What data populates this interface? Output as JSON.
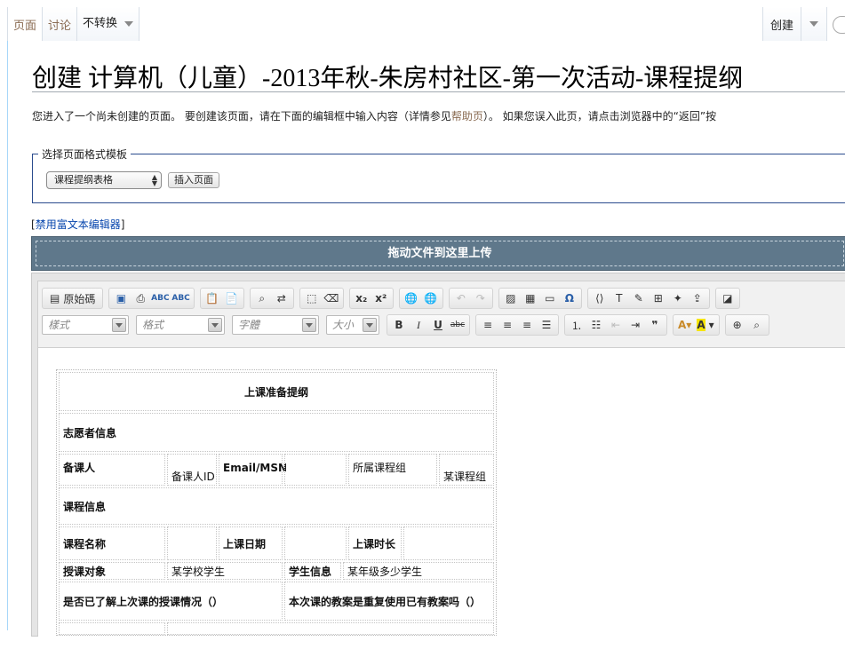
{
  "tabs": {
    "page": "页面",
    "talk": "讨论",
    "variant": "不转换",
    "create": "创建"
  },
  "title": "创建 计算机（儿童）-2013年秋-朱房村社区-第一次活动-课程提纲",
  "intro": {
    "before": "您进入了一个尚未创建的页面。 要创建该页面，请在下面的编辑框中输入内容（详情参见",
    "link": "帮助页",
    "after": "）。 如果您误入此页，请点击浏览器中的“返回”按"
  },
  "template_box": {
    "legend": "选择页面格式模板",
    "selected": "课程提纲表格",
    "insert_button": "插入页面"
  },
  "rte_toggle": {
    "open": "[",
    "link": "禁用富文本编辑器",
    "close": "]"
  },
  "upload": {
    "label": "拖动文件到这里上传"
  },
  "toolbar": {
    "source": "原始碼",
    "styles": "樣式",
    "format": "格式",
    "font": "字體",
    "size": "大小",
    "spell1": "ABC",
    "spell2": "ABC",
    "strike": "abc"
  },
  "doc": {
    "heading": "上课准备提纲",
    "volunteer_info": "志愿者信息",
    "preparer": "备课人",
    "preparer_id": "备课人ID",
    "email": "Email/MSN",
    "course_group": "所属课程组",
    "course_group_value": "某课程组",
    "course_info": "课程信息",
    "course_name": "课程名称",
    "class_date": "上课日期",
    "duration": "上课时长",
    "audience": "授课对象",
    "audience_value": "某学校学生",
    "student_info": "学生信息",
    "student_info_value": "某年级多少学生",
    "q_last": "是否已了解上次课的授课情况（）",
    "q_reuse": "本次课的教案是重复使用已有教案吗（）"
  },
  "colors": {
    "tab_link": "#8a6b52",
    "upload_bar": "#5f788b",
    "fieldset_border": "#2a4b8d",
    "link": "#0645ad"
  }
}
